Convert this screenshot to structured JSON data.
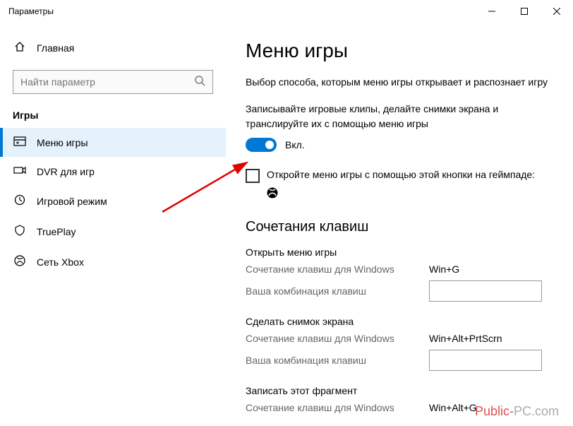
{
  "titlebar": {
    "title": "Параметры"
  },
  "sidebar": {
    "home": "Главная",
    "searchPlaceholder": "Найти параметр",
    "section": "Игры",
    "items": [
      {
        "label": "Меню игры"
      },
      {
        "label": "DVR для игр"
      },
      {
        "label": "Игровой режим"
      },
      {
        "label": "TruePlay"
      },
      {
        "label": "Сеть Xbox"
      }
    ]
  },
  "main": {
    "title": "Меню игры",
    "description": "Выбор способа, которым меню игры открывает и распознает игру",
    "toggleDesc": "Записывайте игровые клипы, делайте снимки экрана и транслируйте их с помощью меню игры",
    "toggleState": "Вкл.",
    "checkboxLabel": "Откройте меню игры с помощью этой кнопки на геймпаде:",
    "shortcutsHeading": "Сочетания клавиш",
    "groups": [
      {
        "title": "Открыть меню игры",
        "winLabel": "Сочетание клавиш для Windows",
        "winValue": "Win+G",
        "userLabel": "Ваша комбинация клавиш"
      },
      {
        "title": "Сделать снимок экрана",
        "winLabel": "Сочетание клавиш для Windows",
        "winValue": "Win+Alt+PrtScrn",
        "userLabel": "Ваша комбинация клавиш"
      },
      {
        "title": "Записать этот фрагмент",
        "winLabel": "Сочетание клавиш для Windows",
        "winValue": "Win+Alt+G"
      }
    ]
  },
  "watermark": {
    "red": "Public-",
    "rest": "PC.com"
  }
}
